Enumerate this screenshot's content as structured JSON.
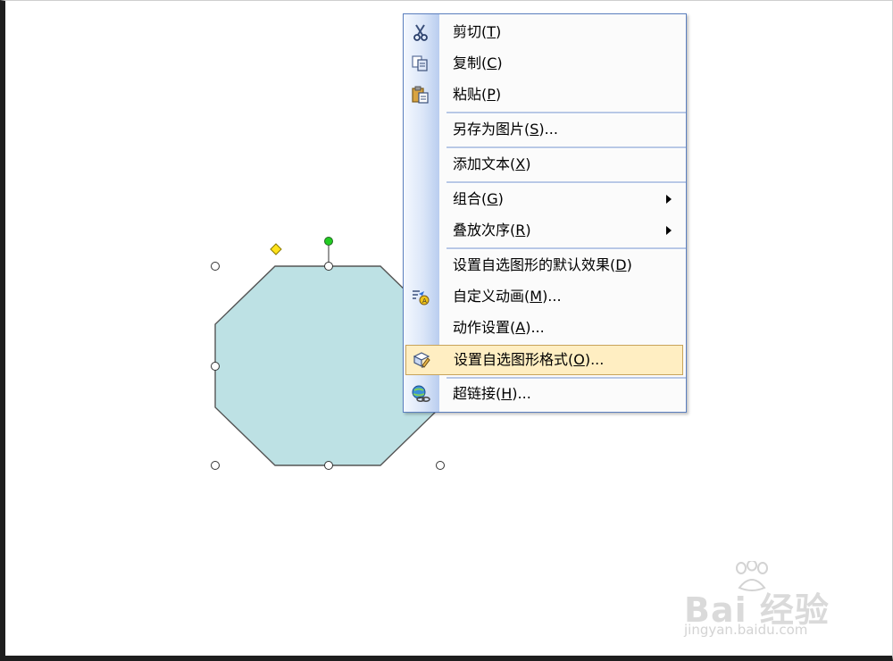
{
  "colors": {
    "shape_fill": "#bde1e4",
    "shape_stroke": "#555555",
    "rotation_handle": "#22cc22",
    "adjust_handle": "#ffe21a",
    "menu_border": "#5b7fbf",
    "menu_highlight": "#ffeec2"
  },
  "context_menu": {
    "items": [
      {
        "label": "剪切(",
        "key": "T",
        "suffix": ")",
        "icon": "scissors-icon",
        "submenu": false
      },
      {
        "label": "复制(",
        "key": "C",
        "suffix": ")",
        "icon": "copy-icon",
        "submenu": false
      },
      {
        "label": "粘贴(",
        "key": "P",
        "suffix": ")",
        "icon": "paste-icon",
        "submenu": false
      },
      {
        "label": "另存为图片(",
        "key": "S",
        "suffix": ")...",
        "icon": "",
        "submenu": false
      },
      {
        "label": "添加文本(",
        "key": "X",
        "suffix": ")",
        "icon": "",
        "submenu": false
      },
      {
        "label": "组合(",
        "key": "G",
        "suffix": ")",
        "icon": "",
        "submenu": true
      },
      {
        "label": "叠放次序(",
        "key": "R",
        "suffix": ")",
        "icon": "",
        "submenu": true
      },
      {
        "label": "设置自选图形的默认效果(",
        "key": "D",
        "suffix": ")",
        "icon": "",
        "submenu": false
      },
      {
        "label": "自定义动画(",
        "key": "M",
        "suffix": ")...",
        "icon": "custom-animation-icon",
        "submenu": false
      },
      {
        "label": "动作设置(",
        "key": "A",
        "suffix": ")...",
        "icon": "",
        "submenu": false
      },
      {
        "label": "设置自选图形格式(",
        "key": "O",
        "suffix": ")...",
        "icon": "format-shape-icon",
        "submenu": false,
        "highlighted": true
      },
      {
        "label": "超链接(",
        "key": "H",
        "suffix": ")...",
        "icon": "hyperlink-icon",
        "submenu": false
      }
    ]
  },
  "watermark": {
    "brand": "Bai  经验",
    "url": "jingyan.baidu.com"
  }
}
